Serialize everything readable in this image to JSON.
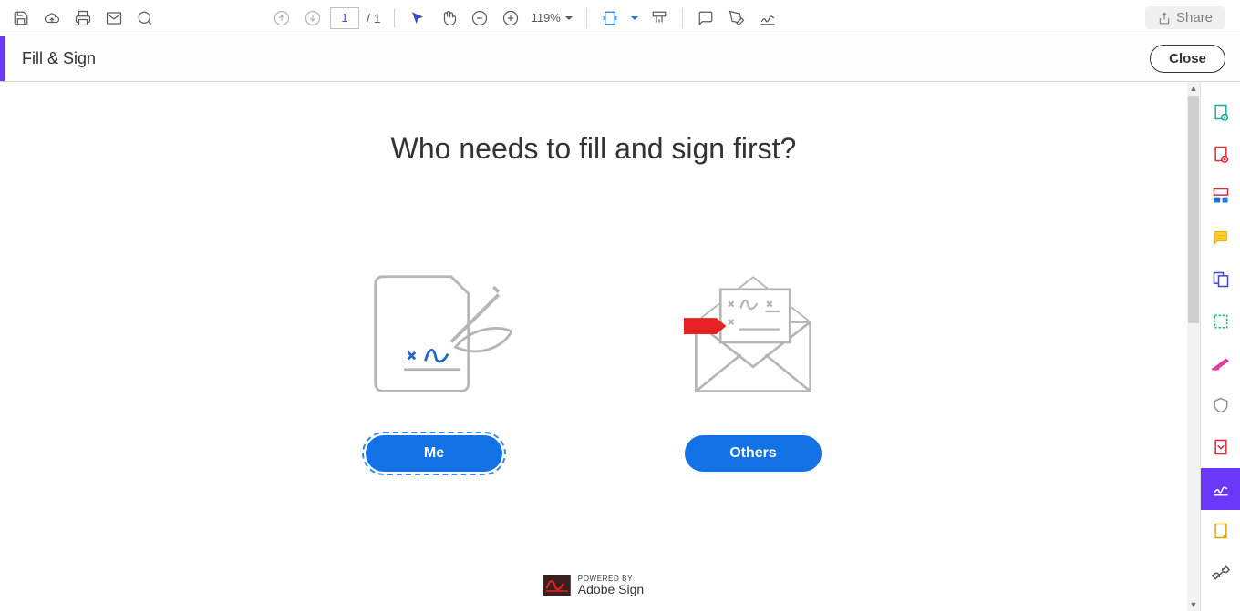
{
  "toolbar": {
    "page_current": "1",
    "page_total": "/ 1",
    "zoom": "119%",
    "share_label": "Share"
  },
  "subtoolbar": {
    "title": "Fill & Sign",
    "close_label": "Close"
  },
  "main": {
    "headline": "Who needs to fill and sign first?",
    "option_me_label": "Me",
    "option_others_label": "Others"
  },
  "powered": {
    "label": "POWERED BY",
    "brand": "Adobe Sign"
  },
  "colors": {
    "accent_purple": "#6b38fb",
    "primary_blue": "#1373E6"
  }
}
